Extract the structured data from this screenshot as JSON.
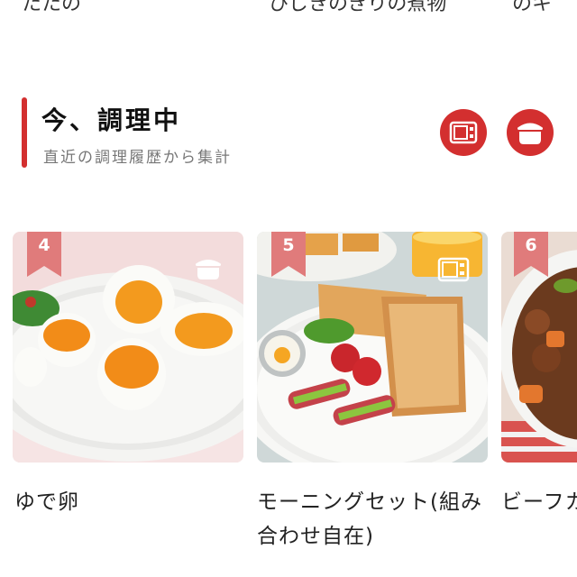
{
  "top_row": {
    "items": [
      "たたの",
      "ひじきのきりの煮物",
      "のキ"
    ]
  },
  "section": {
    "title": "今、調理中",
    "subtitle": "直近の調理履歴から集計",
    "accent_color": "#d32f2f"
  },
  "filter_buttons": [
    {
      "icon": "microwave-icon"
    },
    {
      "icon": "rice-cooker-icon"
    }
  ],
  "cards": [
    {
      "rank": "4",
      "title": "ゆで卵",
      "appliance_icon": "rice-cooker-icon"
    },
    {
      "rank": "5",
      "title": "モーニングセット(組み合わせ自在)",
      "appliance_icon": "microwave-icon"
    },
    {
      "rank": "6",
      "title": "ビーフカ",
      "appliance_icon": ""
    }
  ]
}
